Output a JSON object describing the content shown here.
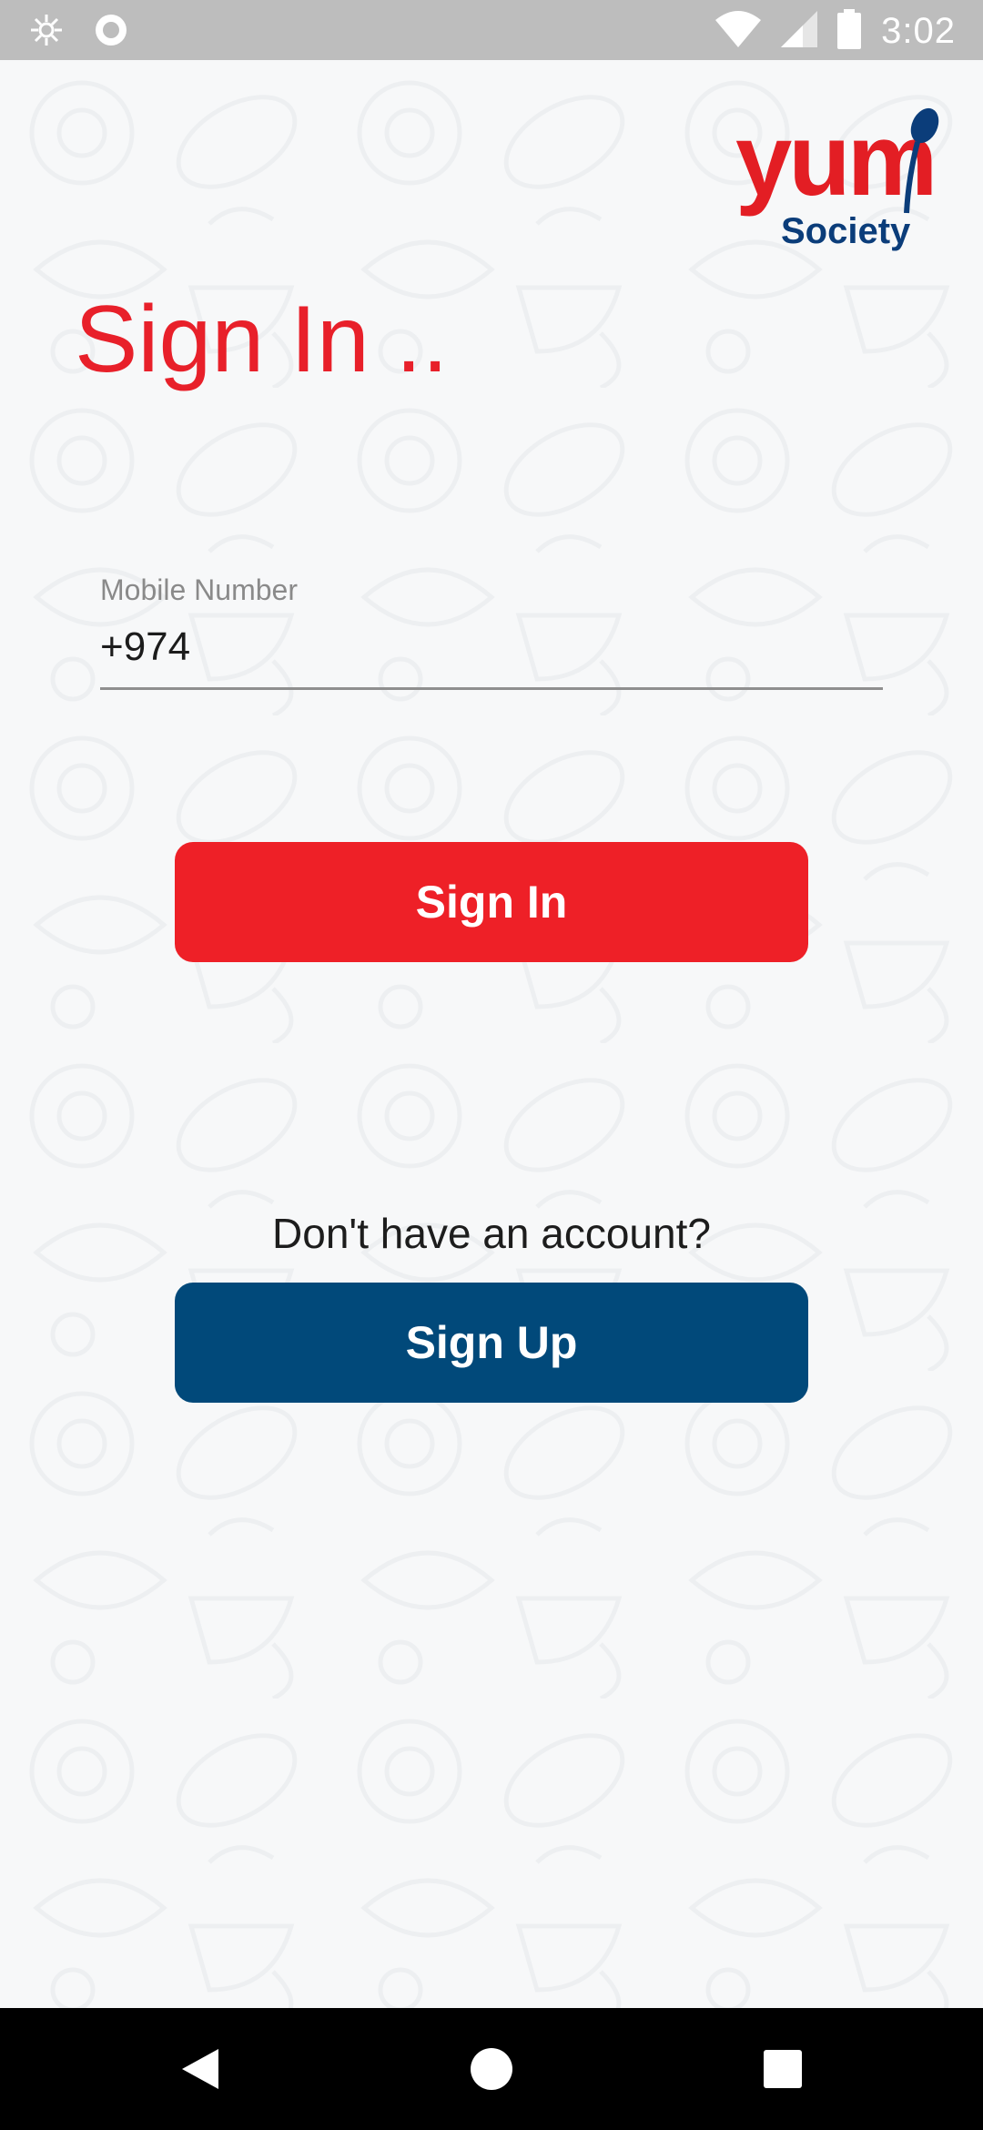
{
  "status_bar": {
    "time": "3:02",
    "left_icons": [
      "app-notification-icon",
      "circle-notification-icon"
    ],
    "right_icons": [
      "wifi-icon",
      "cell-signal-icon",
      "battery-icon"
    ]
  },
  "logo": {
    "brand_top": "yum",
    "brand_bottom": "Society"
  },
  "page": {
    "title": "Sign In .."
  },
  "form": {
    "mobile_label": "Mobile Number",
    "mobile_value": "+974"
  },
  "actions": {
    "signin_label": "Sign In",
    "no_account_text": "Don't have an account?",
    "signup_label": "Sign Up"
  },
  "nav_bar": {
    "buttons": [
      "back-icon",
      "home-icon",
      "recents-icon"
    ]
  },
  "colors": {
    "primary_red": "#ee2027",
    "primary_blue": "#01497a",
    "title_red": "#e8202a",
    "background": "#f7f8f9"
  }
}
